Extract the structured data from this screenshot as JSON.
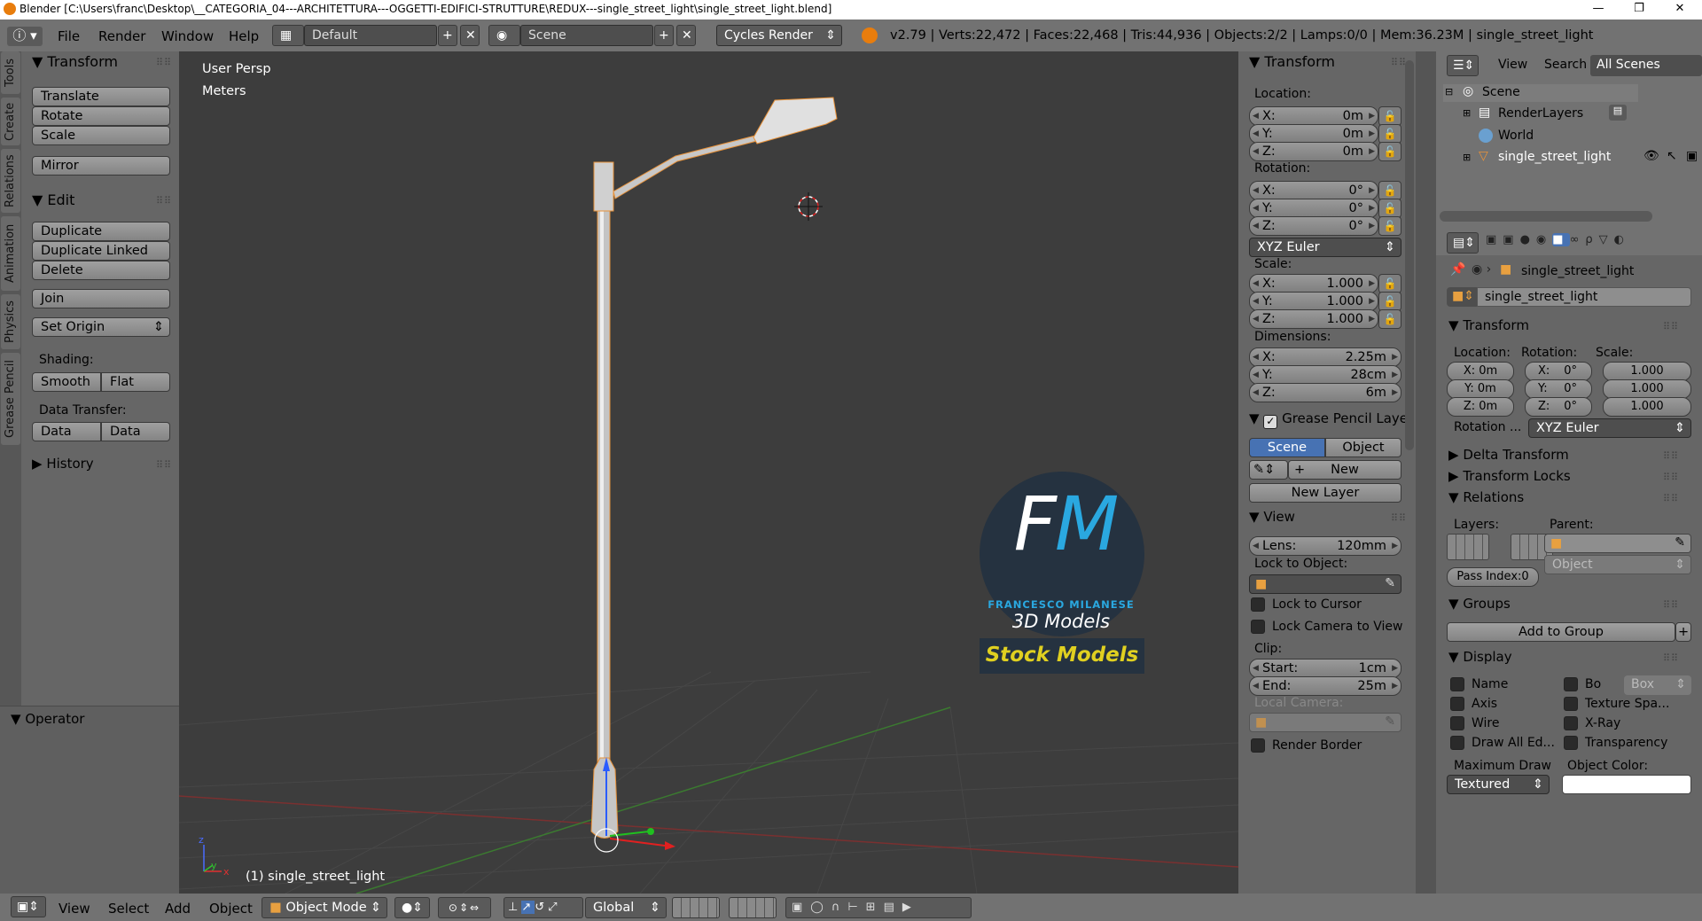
{
  "titlebar": {
    "title": "Blender [C:\\Users\\franc\\Desktop\\__CATEGORIA_04---ARCHITETTURA---OGGETTI-EDIFICI-STRUTTURE\\REDUX---single_street_light\\single_street_light.blend]",
    "minimize": "—",
    "maximize": "❐",
    "close": "✕"
  },
  "infobar": {
    "menus": [
      "File",
      "Render",
      "Window",
      "Help"
    ],
    "layout": "Default",
    "scene": "Scene",
    "engine": "Cycles Render",
    "stats": "v2.79 | Verts:22,472 | Faces:22,468 | Tris:44,936 | Objects:2/2 | Lamps:0/0 | Mem:36.23M | single_street_light"
  },
  "lefttabs": [
    "Tools",
    "Create",
    "Relations",
    "Animation",
    "Physics",
    "Grease Pencil"
  ],
  "toolshelf": {
    "transform_title": "Transform",
    "translate": "Translate",
    "rotate": "Rotate",
    "scale": "Scale",
    "mirror": "Mirror",
    "edit_title": "Edit",
    "duplicate": "Duplicate",
    "duplicate_linked": "Duplicate Linked",
    "delete": "Delete",
    "join": "Join",
    "set_origin": "Set Origin",
    "shading_label": "Shading:",
    "smooth": "Smooth",
    "flat": "Flat",
    "data_transfer_label": "Data Transfer:",
    "data": "Data",
    "data_layo": "Data Layo",
    "history": "History",
    "operator": "Operator"
  },
  "viewport": {
    "view_name": "User Persp",
    "units": "Meters",
    "object_label": "(1) single_street_light",
    "watermark_fm": "FM",
    "watermark_name": "FRANCESCO MILANESE",
    "watermark_sub": "3D Models",
    "watermark_stock": "Stock Models"
  },
  "npanel": {
    "transform_title": "Transform",
    "location_label": "Location:",
    "loc_x": "0m",
    "loc_y": "0m",
    "loc_z": "0m",
    "rotation_label": "Rotation:",
    "rot_x": "0°",
    "rot_y": "0°",
    "rot_z": "0°",
    "rotation_mode": "XYZ Euler",
    "scale_label": "Scale:",
    "scale_x": "1.000",
    "scale_y": "1.000",
    "scale_z": "1.000",
    "dimensions_label": "Dimensions:",
    "dim_x": "2.25m",
    "dim_y": "28cm",
    "dim_z": "6m",
    "grease_title": "Grease Pencil Layer",
    "scene_btn": "Scene",
    "object_btn": "Object",
    "new_btn": "New",
    "new_layer_btn": "New Layer",
    "view_title": "View",
    "lens_label": "Lens:",
    "lens_value": "120mm",
    "lock_object_label": "Lock to Object:",
    "lock_cursor": "Lock to Cursor",
    "lock_camera": "Lock Camera to View",
    "clip_label": "Clip:",
    "start_label": "Start:",
    "start_value": "1cm",
    "end_label": "End:",
    "end_value": "25m",
    "local_camera": "Local Camera:",
    "render_border": "Render Border"
  },
  "outliner": {
    "view": "View",
    "search": "Search",
    "all_scenes": "All Scenes",
    "items": [
      {
        "label": "Scene"
      },
      {
        "label": "RenderLayers"
      },
      {
        "label": "World"
      },
      {
        "label": "single_street_light"
      }
    ]
  },
  "props": {
    "breadcrumb": "single_street_light",
    "object_name": "single_street_light",
    "transform_title": "Transform",
    "location_label": "Location:",
    "rotation_label": "Rotation:",
    "scale_label": "Scale:",
    "lx": "X: 0m",
    "ly": "Y: 0m",
    "lz": "Z: 0m",
    "rx": "X:",
    "ry": "Y:",
    "rz": "Z:",
    "rv": "0°",
    "sx": "1.000",
    "sy": "1.000",
    "sz": "1.000",
    "rotation_mode_label": "Rotation ...",
    "rotation_mode": "XYZ Euler",
    "delta_transform": "Delta Transform",
    "transform_locks": "Transform Locks",
    "relations_title": "Relations",
    "layers_label": "Layers:",
    "parent_label": "Parent:",
    "parent_type": "Object",
    "pass_index": "Pass Index:0",
    "groups_title": "Groups",
    "add_to_group": "Add to Group",
    "display_title": "Display",
    "name": "Name",
    "bo": "Bo",
    "box": "Box",
    "axis": "Axis",
    "texture_space": "Texture Spa...",
    "wire": "Wire",
    "xray": "X-Ray",
    "draw_all_edges": "Draw All Ed...",
    "transparency": "Transparency",
    "max_draw_label": "Maximum Draw",
    "max_draw_value": "Textured",
    "object_color_label": "Object Color:"
  },
  "bottombar": {
    "menus": [
      "View",
      "Select",
      "Add",
      "Object"
    ],
    "mode": "Object Mode",
    "orientation": "Global"
  }
}
